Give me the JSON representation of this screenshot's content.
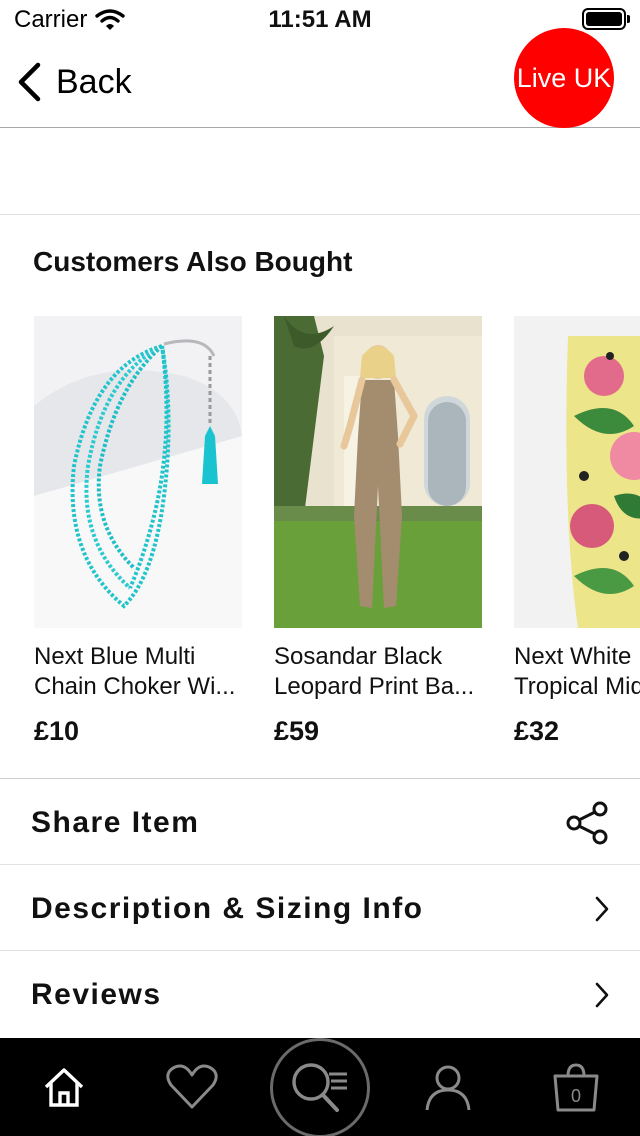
{
  "status_bar": {
    "carrier": "Carrier",
    "time": "11:51 AM"
  },
  "nav": {
    "back_label": "Back",
    "live_badge": "Live UK",
    "badge_color": "#ff0000"
  },
  "related": {
    "title": "Customers Also Bought",
    "products": [
      {
        "name_line1": "Next Blue Multi",
        "name_line2": "Chain Choker Wi...",
        "price": "£10",
        "image": "turquoise-bead-necklace"
      },
      {
        "name_line1": "Sosandar Black",
        "name_line2": "Leopard Print Ba...",
        "price": "£59",
        "image": "leopard-print-jumpsuit"
      },
      {
        "name_line1": "Next White",
        "name_line2": "Tropical Mid",
        "price": "£32",
        "image": "tropical-print-trousers"
      }
    ]
  },
  "actions": {
    "share": {
      "label": "Share Item",
      "icon": "share-icon"
    },
    "description": {
      "label": "Description & Sizing Info",
      "icon": "chevron-right-icon"
    },
    "reviews": {
      "label": "Reviews",
      "icon": "chevron-right-icon"
    }
  },
  "tab_bar": {
    "items": [
      "home-icon",
      "heart-icon",
      "search-icon",
      "account-icon",
      "bag-icon"
    ],
    "bag_count": "0"
  }
}
